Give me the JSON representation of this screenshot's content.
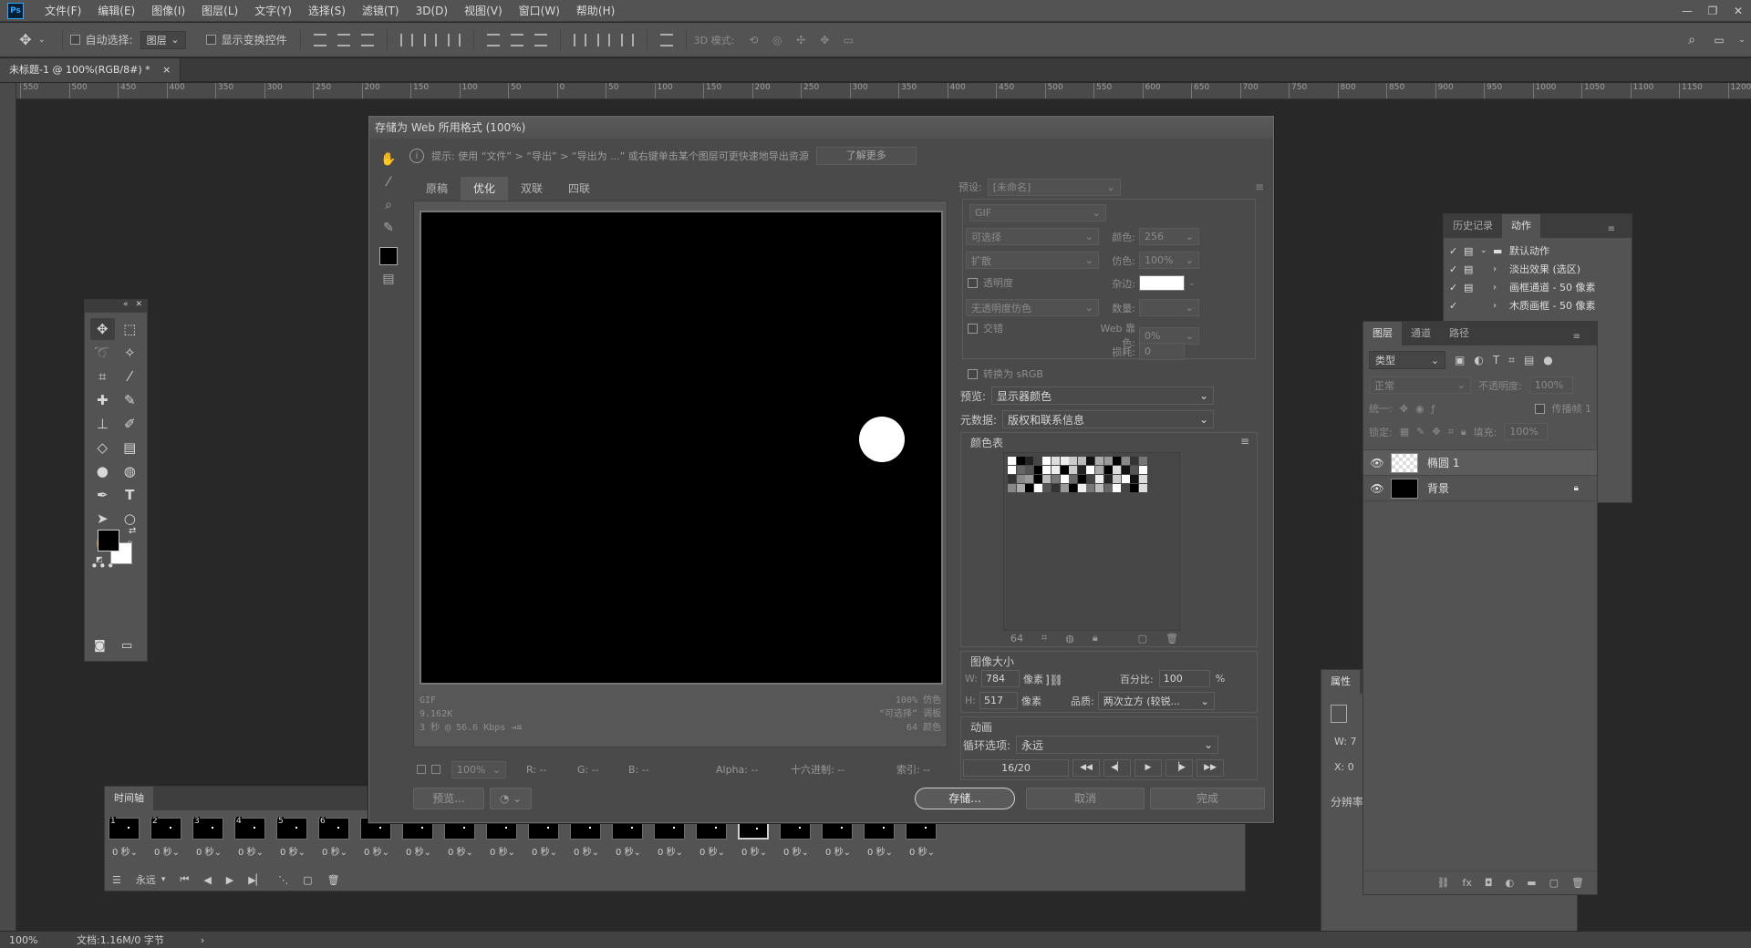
{
  "menubar": {
    "logo": "Ps",
    "items": [
      "文件(F)",
      "编辑(E)",
      "图像(I)",
      "图层(L)",
      "文字(Y)",
      "选择(S)",
      "滤镜(T)",
      "3D(D)",
      "视图(V)",
      "窗口(W)",
      "帮助(H)"
    ],
    "win_controls": [
      "—",
      "❐",
      "✕"
    ]
  },
  "optbar": {
    "auto_select_label": "自动选择:",
    "auto_select_value": "图层",
    "show_transform_label": "显示变换控件",
    "mode_3d_label": "3D 模式:"
  },
  "doc_tab": {
    "title": "未标题-1 @ 100%(RGB/8#) *",
    "close": "×"
  },
  "ruler": {
    "h_labels": [
      "550",
      "500",
      "450",
      "400",
      "350",
      "300",
      "250",
      "200",
      "150",
      "100",
      "50",
      "0",
      "50",
      "100",
      "150",
      "200",
      "250",
      "300",
      "350",
      "400",
      "450",
      "500",
      "550",
      "600",
      "650",
      "700",
      "750",
      "800",
      "850",
      "900",
      "950",
      "1000",
      "1050",
      "1100",
      "1150",
      "1200"
    ]
  },
  "dialog": {
    "title": "存储为 Web 所用格式 (100%)",
    "tip": "提示:  使用 “文件” > “导出” > “导出为 ...” 或右键单击某个图层可更快速地导出资源",
    "learn_more": "了解更多",
    "tabs": [
      "原稿",
      "优化",
      "双联",
      "四联"
    ],
    "active_tab": "优化",
    "preview_info_left": [
      "GIF",
      "9.162K",
      "3 秒 @ 56.6 Kbps  ⇥≡"
    ],
    "preview_info_right": [
      "100% 仿色",
      "“可选择” 调板",
      "64 颜色"
    ],
    "status": {
      "zoom": "100%",
      "r": "R: --",
      "g": "G: --",
      "b": "B: --",
      "alpha": "Alpha: --",
      "hex": "十六进制: --",
      "index": "索引: --"
    },
    "buttons": {
      "preview": "预览...",
      "save": "存储...",
      "cancel": "取消",
      "done": "完成"
    },
    "settings": {
      "preset_label": "预设:",
      "preset_value": "[未命名]",
      "format": "GIF",
      "reduction": "可选择",
      "colors_label": "颜色:",
      "colors_value": "256",
      "dither_algo": "扩散",
      "dither_label": "仿色:",
      "dither_value": "100%",
      "transparency_label": "透明度",
      "matte_label": "杂边:",
      "trans_dither": "无透明度仿色",
      "amount_label": "数量:",
      "interlaced_label": "交错",
      "web_snap_label": "Web 靠色:",
      "web_snap_value": "0%",
      "lossy_label": "损耗:",
      "lossy_value": "0",
      "convert_srgb": "转换为 sRGB",
      "preview_label": "预览:",
      "preview_value": "显示器颜色",
      "metadata_label": "元数据:",
      "metadata_value": "版权和联系信息",
      "color_table_label": "颜色表",
      "color_count": "64",
      "image_size_label": "图像大小",
      "w_label": "W:",
      "w_value": "784",
      "h_label": "H:",
      "h_value": "517",
      "px_unit": "像素",
      "percent_label": "百分比:",
      "percent_value": "100",
      "percent_unit": "%",
      "quality_label": "品质:",
      "quality_value": "两次立方 (较锐...",
      "animation_label": "动画",
      "loop_label": "循环选项:",
      "loop_value": "永远",
      "frame_counter": "16/20"
    }
  },
  "timeline": {
    "title": "时间轴",
    "frames": [
      {
        "n": "1",
        "t": "0 秒"
      },
      {
        "n": "2",
        "t": "0 秒"
      },
      {
        "n": "3",
        "t": "0 秒"
      },
      {
        "n": "4",
        "t": "0 秒"
      },
      {
        "n": "5",
        "t": "0 秒"
      },
      {
        "n": "6",
        "t": "0 秒"
      },
      {
        "n": "",
        "t": "0 秒"
      },
      {
        "n": "",
        "t": "0 秒"
      },
      {
        "n": "",
        "t": "0 秒"
      },
      {
        "n": "",
        "t": "0 秒"
      },
      {
        "n": "",
        "t": "0 秒"
      },
      {
        "n": "",
        "t": "0 秒"
      },
      {
        "n": "",
        "t": "0 秒"
      },
      {
        "n": "",
        "t": "0 秒"
      },
      {
        "n": "",
        "t": "0 秒"
      },
      {
        "n": "",
        "t": "0 秒"
      },
      {
        "n": "",
        "t": "0 秒"
      },
      {
        "n": "",
        "t": "0 秒"
      },
      {
        "n": "",
        "t": "0 秒"
      },
      {
        "n": "",
        "t": "0 秒"
      }
    ],
    "selected_frame": 16,
    "loop": "永远"
  },
  "history_panel": {
    "tabs": [
      "历史记录",
      "动作"
    ],
    "active": "动作",
    "rows": [
      "默认动作",
      "淡出效果 (选区)",
      "画框通道 - 50 像素",
      "木质画框 - 50 像素"
    ]
  },
  "layers_panel": {
    "tabs": [
      "图层",
      "通道",
      "路径"
    ],
    "active": "图层",
    "filter": "类型",
    "blend": "正常",
    "opacity_label": "不透明度:",
    "opacity_value": "100%",
    "unify_label": "统一:",
    "propagate_label": "传播帧 1",
    "lock_label": "锁定:",
    "fill_label": "填充:",
    "fill_value": "100%",
    "layers": [
      {
        "name": "椭圆 1"
      },
      {
        "name": "背景"
      }
    ]
  },
  "props_panel": {
    "title": "属性",
    "w_label": "W:",
    "w_value": "7",
    "x_label": "X:",
    "x_value": "0",
    "res_label": "分辨率"
  },
  "status": {
    "zoom": "100%",
    "doc": "文档:1.16M/0 字节"
  }
}
